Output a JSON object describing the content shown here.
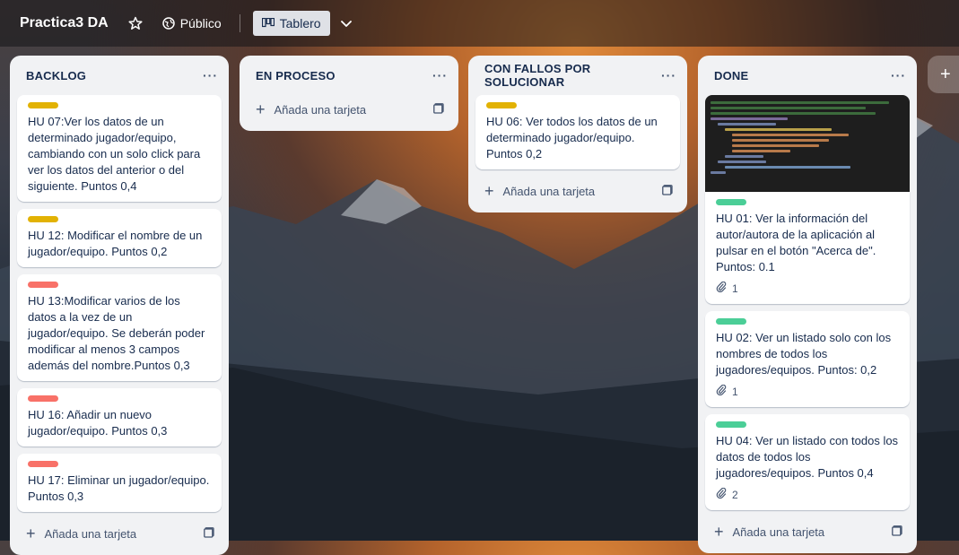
{
  "header": {
    "board_title": "Practica3 DA",
    "visibility": "Público",
    "view": "Tablero"
  },
  "colors": {
    "yellow": "#e2b203",
    "red": "#f87168",
    "green": "#4bce97"
  },
  "lists": [
    {
      "title": "BACKLOG",
      "cards": [
        {
          "label_color": "yellow",
          "text": "HU 07:Ver los datos de un determinado jugador/equipo, cambiando con un solo click para ver los datos del anterior o del siguiente. Puntos 0,4"
        },
        {
          "label_color": "yellow",
          "text": "HU 12: Modificar el nombre de un jugador/equipo. Puntos 0,2"
        },
        {
          "label_color": "red",
          "text": "HU 13:Modificar varios de los datos a la vez de un jugador/equipo. Se deberán poder modificar al menos 3 campos además del nombre.Puntos 0,3"
        },
        {
          "label_color": "red",
          "text": "HU 16: Añadir un nuevo jugador/equipo. Puntos 0,3"
        },
        {
          "label_color": "red",
          "text": "HU 17: Eliminar un jugador/equipo. Puntos 0,3"
        }
      ],
      "add_label": "Añada una tarjeta"
    },
    {
      "title": "EN PROCESO",
      "cards": [],
      "add_label": "Añada una tarjeta"
    },
    {
      "title": "CON FALLOS POR SOLUCIONAR",
      "cards": [
        {
          "label_color": "yellow",
          "text": "HU 06: Ver todos los datos de un determinado jugador/equipo. Puntos 0,2"
        }
      ],
      "add_label": "Añada una tarjeta"
    },
    {
      "title": "DONE",
      "cards": [
        {
          "label_color": "green",
          "text": "HU 01: Ver la información del autor/autora de la aplicación al pulsar en el botón \"Acerca de\". Puntos: 0.1",
          "attachments": "1"
        },
        {
          "label_color": "green",
          "text": "HU 02: Ver un listado solo con los nombres de todos los jugadores/equipos. Puntos: 0,2",
          "attachments": "1"
        },
        {
          "label_color": "green",
          "text": "HU 04: Ver un listado con todos los datos de todos los jugadores/equipos. Puntos 0,4",
          "attachments": "2"
        }
      ],
      "add_label": "Añada una tarjeta"
    }
  ]
}
